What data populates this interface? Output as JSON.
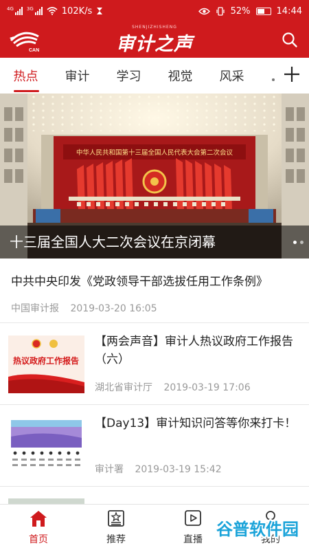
{
  "status_bar": {
    "net1": "4G",
    "net2": "3G",
    "speed": "102K/s",
    "battery": "52%",
    "time": "14:44"
  },
  "header": {
    "brand": "审计之声",
    "brand_sub": "SHENJIZHISHENG",
    "logo_text": "CAN"
  },
  "tabs": [
    "热点",
    "审计",
    "学习",
    "视觉",
    "风采"
  ],
  "hero": {
    "banner_text": "中华人民共和国第十三届全国人民代表大会第二次会议",
    "caption": "十三届全国人大二次会议在京闭幕"
  },
  "news": [
    {
      "title": "中共中央印发《党政领导干部选拔任用工作条例》",
      "source": "中国审计报",
      "time": "2019-03-20 16:05"
    },
    {
      "title": "【两会声音】审计人热议政府工作报告（六）",
      "source": "湖北省审计厅",
      "time": "2019-03-19 17:06",
      "thumb_text": "热议政府工作报告"
    },
    {
      "title": "【Day13】审计知识问答等你来打卡！",
      "source": "审计署",
      "time": "2019-03-19 15:42"
    }
  ],
  "bottom_nav": [
    {
      "label": "首页",
      "icon": "home-icon"
    },
    {
      "label": "推荐",
      "icon": "recommend-icon"
    },
    {
      "label": "直播",
      "icon": "live-icon"
    },
    {
      "label": "我的",
      "icon": "profile-icon"
    }
  ],
  "watermark": "谷普软件园",
  "colors": {
    "brand_red": "#cf1a1d",
    "text": "#222222",
    "meta": "#999999",
    "watermark": "#1aa3d9"
  }
}
